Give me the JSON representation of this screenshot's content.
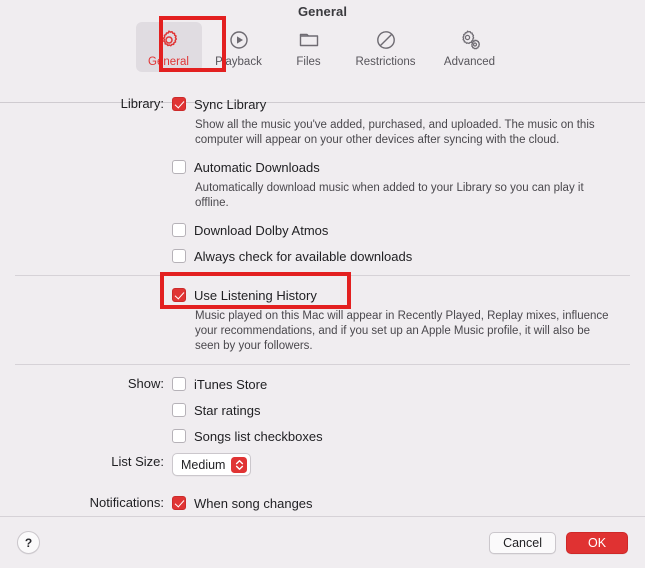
{
  "window": {
    "title": "General"
  },
  "toolbar": {
    "tabs": [
      {
        "label": "General",
        "icon": "gear-icon",
        "selected": true
      },
      {
        "label": "Playback",
        "icon": "play-circle-icon",
        "selected": false
      },
      {
        "label": "Files",
        "icon": "folder-icon",
        "selected": false
      },
      {
        "label": "Restrictions",
        "icon": "no-entry-icon",
        "selected": false
      },
      {
        "label": "Advanced",
        "icon": "double-gear-icon",
        "selected": false
      }
    ]
  },
  "sections": {
    "library": {
      "label": "Library:",
      "sync_library": {
        "label": "Sync Library",
        "checked": true,
        "description": "Show all the music you've added, purchased, and uploaded. The music on this computer will appear on your other devices after syncing with the cloud."
      },
      "automatic_downloads": {
        "label": "Automatic Downloads",
        "checked": false,
        "description": "Automatically download music when added to your Library so you can play it offline."
      },
      "download_dolby_atmos": {
        "label": "Download Dolby Atmos",
        "checked": false
      },
      "always_check_downloads": {
        "label": "Always check for available downloads",
        "checked": false
      }
    },
    "listening_history": {
      "label": "Use Listening History",
      "checked": true,
      "description": "Music played on this Mac will appear in Recently Played, Replay mixes, influence your recommendations, and if you set up an Apple Music profile, it will also be seen by your followers."
    },
    "show": {
      "label": "Show:",
      "items": [
        {
          "label": "iTunes Store",
          "checked": false
        },
        {
          "label": "Star ratings",
          "checked": false
        },
        {
          "label": "Songs list checkboxes",
          "checked": false
        }
      ]
    },
    "list_size": {
      "label": "List Size:",
      "value": "Medium"
    },
    "notifications": {
      "label": "Notifications:",
      "when_song_changes": {
        "label": "When song changes",
        "checked": true
      }
    }
  },
  "footer": {
    "help_label": "?",
    "cancel_label": "Cancel",
    "ok_label": "OK"
  },
  "colors": {
    "accent_red": "#e03434",
    "ok_button_red": "#e03232",
    "annotation_red": "#e32020",
    "window_background": "#f0edf0",
    "selected_tab_background": "#e0dce1"
  }
}
